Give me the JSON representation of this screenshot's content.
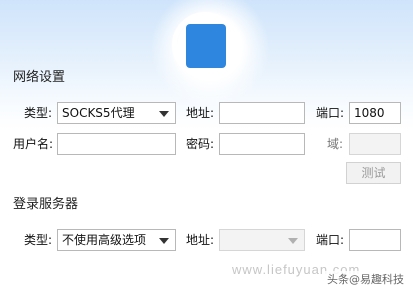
{
  "network": {
    "title": "网络设置",
    "type_label": "类型:",
    "type_value": "SOCKS5代理",
    "address_label": "地址:",
    "address_value": "",
    "port_label": "端口:",
    "port_value": "1080",
    "username_label": "用户名:",
    "username_value": "",
    "password_label": "密码:",
    "password_value": "",
    "domain_label": "域:",
    "domain_value": "",
    "test_button": "测试"
  },
  "login_server": {
    "title": "登录服务器",
    "type_label": "类型:",
    "type_value": "不使用高级选项",
    "address_label": "地址:",
    "address_value": "",
    "port_label": "端口:",
    "port_value": ""
  },
  "watermark": {
    "url": "www.liefuyuan.com",
    "badge": "头条@易趣科技"
  },
  "colors": {
    "banner_top": "#cfe4fb",
    "logo_blue": "#2e86de"
  }
}
